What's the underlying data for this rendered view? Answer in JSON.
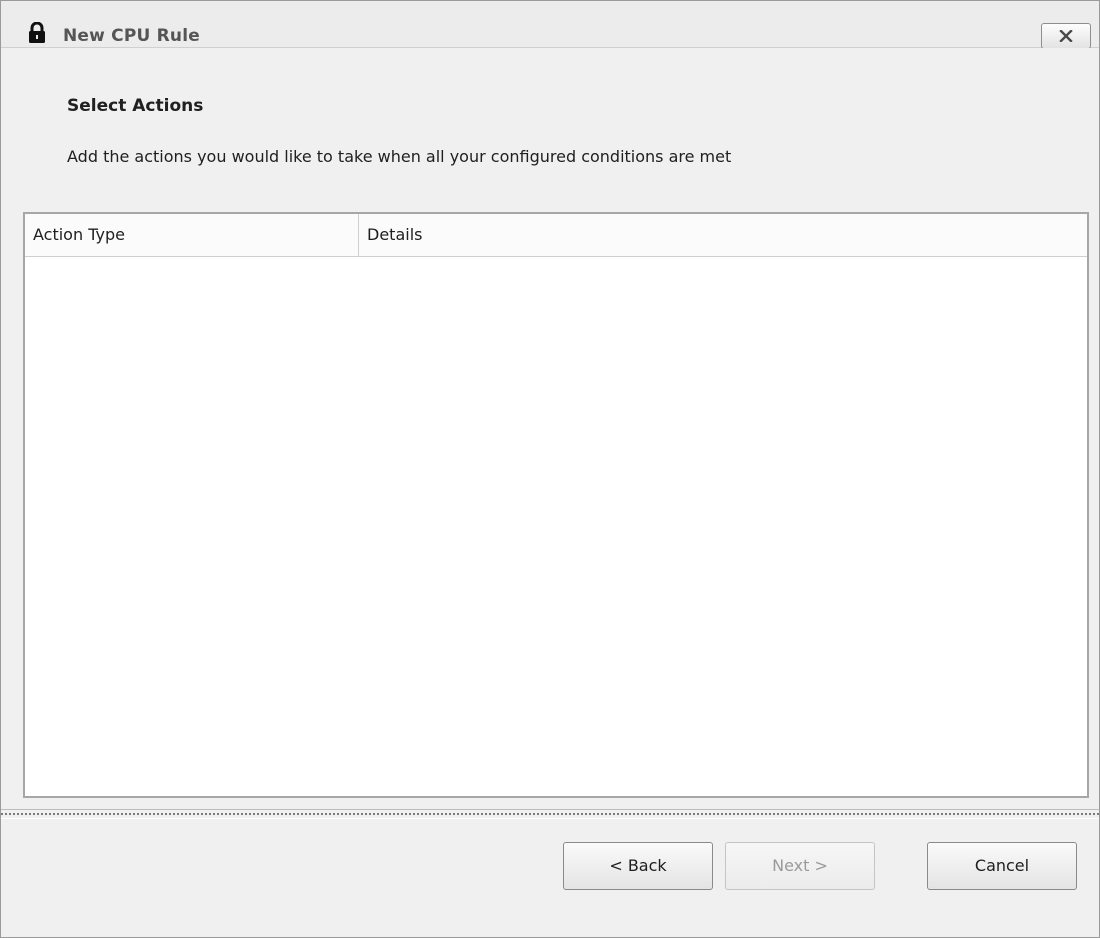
{
  "window": {
    "title": "New CPU Rule",
    "icon": "lock-icon",
    "close_icon": "close-icon"
  },
  "wizard": {
    "step_title": "Select Actions",
    "step_description": "Add the actions you would like to take when all your configured conditions are met"
  },
  "actions_table": {
    "columns": [
      "Action Type",
      "Details"
    ],
    "rows": []
  },
  "buttons": {
    "back": "< Back",
    "next": "Next >",
    "cancel": "Cancel",
    "next_enabled": false
  }
}
